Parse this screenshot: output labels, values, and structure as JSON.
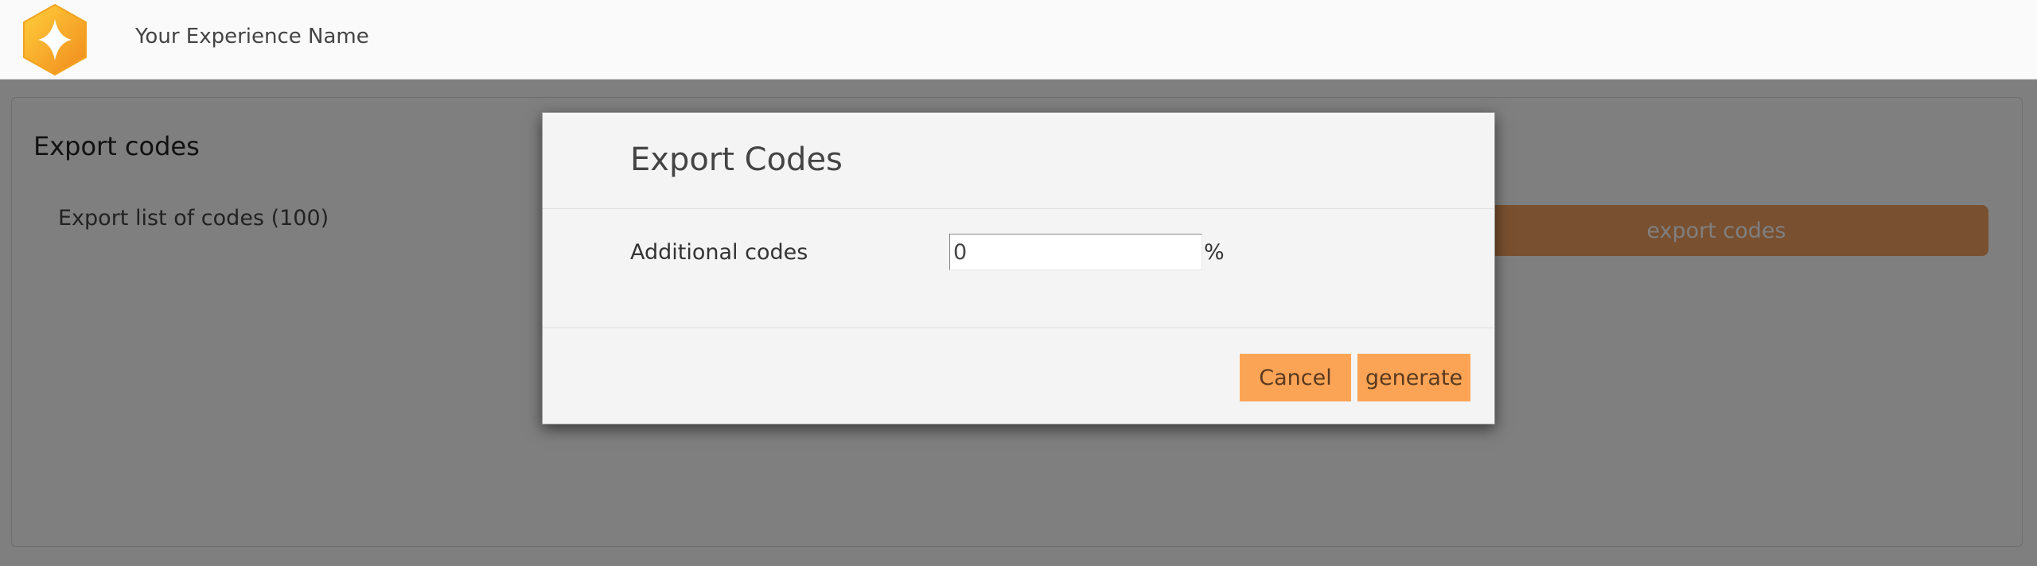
{
  "header": {
    "app_name": "Your Experience Name",
    "logo_icon": "hexagon-star-logo-icon"
  },
  "panel": {
    "title": "Export codes",
    "subtitle": "Export list of codes (100)",
    "export_button_label": "export codes"
  },
  "modal": {
    "title": "Export Codes",
    "field_label": "Additional codes",
    "field_value": "0",
    "field_unit": "%",
    "cancel_label": "Cancel",
    "generate_label": "generate"
  },
  "colors": {
    "accent": "#fca455",
    "overlay": "rgba(0,0,0,0.5)"
  }
}
